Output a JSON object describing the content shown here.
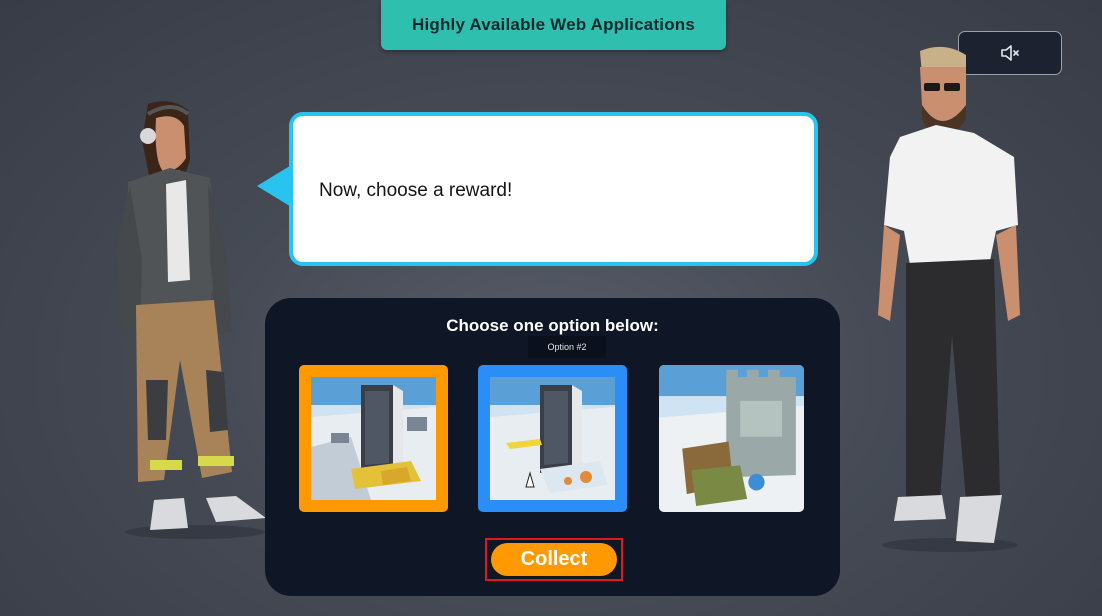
{
  "header": {
    "title": "Highly Available Web Applications"
  },
  "controls": {
    "mute_icon": "speaker-muted-icon"
  },
  "dialogue": {
    "text": "Now, choose a reward!"
  },
  "rewards": {
    "title": "Choose one option below:",
    "tooltip": "Option #2",
    "options": [
      {
        "name": "reward-option-1",
        "state": "selected"
      },
      {
        "name": "reward-option-2",
        "state": "hovered"
      },
      {
        "name": "reward-option-3",
        "state": "default"
      }
    ],
    "collect_label": "Collect"
  },
  "colors": {
    "accent_teal": "#2fbfae",
    "bubble_border": "#28c3ef",
    "selected_orange": "#ff9900",
    "hover_blue": "#2a8ef6",
    "panel_bg": "#0f1726",
    "highlight_red": "#e01a1a"
  }
}
